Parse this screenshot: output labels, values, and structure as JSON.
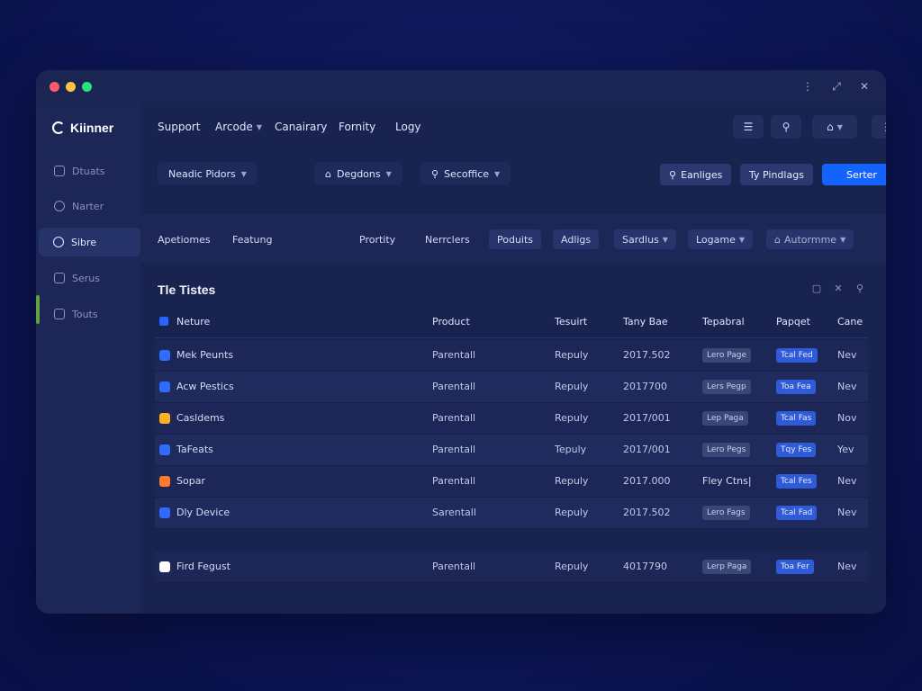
{
  "app": {
    "brand": "Kiinner"
  },
  "sidebar": {
    "items": [
      {
        "label": "Dtuats",
        "icon": "box-icon"
      },
      {
        "label": "Narter",
        "icon": "settings-icon"
      },
      {
        "label": "Sibre",
        "icon": "search-icon"
      },
      {
        "label": "Serus",
        "icon": "grid-icon"
      },
      {
        "label": "Touts",
        "icon": "toolbox-icon"
      }
    ],
    "active_index": 2
  },
  "nav": {
    "links": [
      "Support",
      "Arcode",
      "Canairary",
      "Fornity",
      "Logy"
    ]
  },
  "filters": [
    {
      "label": "Neadic Pidors",
      "icon": ""
    },
    {
      "label": "Degdons",
      "icon": "home-icon"
    },
    {
      "label": "Secoffice",
      "icon": "search-icon"
    }
  ],
  "actions": {
    "engines": "Eanliges",
    "findings": "Ty Pindlags",
    "primary": "Serter"
  },
  "tabs": [
    "Apetiomes",
    "Featung",
    "Prortity",
    "Nerrclers",
    "Poduits",
    "Adligs",
    "Sardlus",
    "Logame",
    "Autormme"
  ],
  "table": {
    "title": "Tle Tistes",
    "columns": [
      "Neture",
      "Product",
      "Tesuirt",
      "Tany Bae",
      "Tepabral",
      "Papqet",
      "Cane"
    ],
    "rows": [
      {
        "name": "Mek Peunts",
        "product": "Parentall",
        "status": "Repuly",
        "date": "2017.502",
        "tag1": "Lero Page",
        "tag2": "Tcal Fed",
        "last": "Nev",
        "icon_color": "#2f6bff"
      },
      {
        "name": "Acw Pestics",
        "product": "Parentall",
        "status": "Repuly",
        "date": "2017700",
        "tag1": "Lers Pegp",
        "tag2": "Toa Fea",
        "last": "Nev",
        "icon_color": "#2f6bff"
      },
      {
        "name": "Casldems",
        "product": "Parentall",
        "status": "Repuly",
        "date": "2017/001",
        "tag1": "Lep Paga",
        "tag2": "Tcal Fas",
        "last": "Nov",
        "icon_color": "#ffb020"
      },
      {
        "name": "TaFeats",
        "product": "Parentall",
        "status": "Tepuly",
        "date": "2017/001",
        "tag1": "Lero Pegs",
        "tag2": "Tqy Fes",
        "last": "Yev",
        "icon_color": "#2f6bff"
      },
      {
        "name": "Sopar",
        "product": "Parentall",
        "status": "Repuly",
        "date": "2017.000",
        "tag1": "Fley Ctns|",
        "tag1_plain": true,
        "tag2": "Tcal Fes",
        "last": "Nev",
        "icon_color": "#ff7a2f"
      },
      {
        "name": "Dly Device",
        "product": "Sarentall",
        "status": "Repuly",
        "date": "2017.502",
        "tag1": "Lero Fags",
        "tag2": "Tcal Fad",
        "last": "Nev",
        "icon_color": "#2f6bff"
      },
      {
        "name": "Fird Fegust",
        "product": "Parentall",
        "status": "Repuly",
        "date": "4017790",
        "tag1": "Lerp Paga",
        "tag2": "Toa Fer",
        "last": "Nev",
        "icon_color": "#ffffff"
      }
    ]
  }
}
